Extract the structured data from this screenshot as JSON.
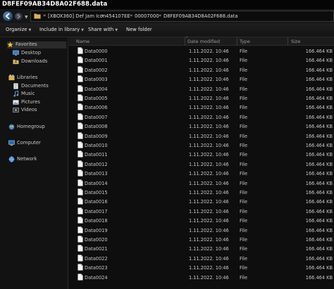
{
  "window": {
    "title": "D8FEF09AB34D8A02F688.data"
  },
  "address": {
    "segments": [
      "[XBOX360] Def Jam Icon",
      "454107EE",
      "00007000",
      "D8FEF09AB34D8A02F688.data"
    ],
    "separator": "»"
  },
  "toolbar": {
    "organize": "Organize",
    "include_in_library": "Include in library",
    "share_with": "Share with",
    "new_folder": "New folder",
    "dropdown_arrow": "▼"
  },
  "sidebar": {
    "favorites": "Favorites",
    "desktop": "Desktop",
    "downloads": "Downloads",
    "libraries": "Libraries",
    "documents": "Documents",
    "music": "Music",
    "pictures": "Pictures",
    "videos": "Videos",
    "homegroup": "Homegroup",
    "computer": "Computer",
    "network": "Network"
  },
  "columns": {
    "name": "Name",
    "date_modified": "Date modified",
    "type": "Type",
    "size": "Size"
  },
  "files": [
    {
      "name": "Data0000",
      "date": "1.11.2022. 10:46",
      "type": "File",
      "size": "166.464 KB"
    },
    {
      "name": "Data0001",
      "date": "1.11.2022. 10:46",
      "type": "File",
      "size": "166.464 KB"
    },
    {
      "name": "Data0002",
      "date": "1.11.2022. 10:46",
      "type": "File",
      "size": "166.464 KB"
    },
    {
      "name": "Data0003",
      "date": "1.11.2022. 10:46",
      "type": "File",
      "size": "166.464 KB"
    },
    {
      "name": "Data0004",
      "date": "1.11.2022. 10:46",
      "type": "File",
      "size": "166.464 KB"
    },
    {
      "name": "Data0005",
      "date": "1.11.2022. 10:46",
      "type": "File",
      "size": "166.464 KB"
    },
    {
      "name": "Data0006",
      "date": "1.11.2022. 10:46",
      "type": "File",
      "size": "166.464 KB"
    },
    {
      "name": "Data0007",
      "date": "1.11.2022. 10:46",
      "type": "File",
      "size": "166.464 KB"
    },
    {
      "name": "Data0008",
      "date": "1.11.2022. 10:46",
      "type": "File",
      "size": "166.464 KB"
    },
    {
      "name": "Data0009",
      "date": "1.11.2022. 10:46",
      "type": "File",
      "size": "166.464 KB"
    },
    {
      "name": "Data0010",
      "date": "1.11.2022. 10:46",
      "type": "File",
      "size": "166.464 KB"
    },
    {
      "name": "Data0011",
      "date": "1.11.2022. 10:46",
      "type": "File",
      "size": "166.464 KB"
    },
    {
      "name": "Data0012",
      "date": "1.11.2022. 10:46",
      "type": "File",
      "size": "166.464 KB"
    },
    {
      "name": "Data0013",
      "date": "1.11.2022. 10:46",
      "type": "File",
      "size": "166.464 KB"
    },
    {
      "name": "Data0014",
      "date": "1.11.2022. 10:46",
      "type": "File",
      "size": "166.464 KB"
    },
    {
      "name": "Data0015",
      "date": "1.11.2022. 10:46",
      "type": "File",
      "size": "166.464 KB"
    },
    {
      "name": "Data0016",
      "date": "1.11.2022. 10:46",
      "type": "File",
      "size": "166.464 KB"
    },
    {
      "name": "Data0017",
      "date": "1.11.2022. 10:46",
      "type": "File",
      "size": "166.464 KB"
    },
    {
      "name": "Data0018",
      "date": "1.11.2022. 10:46",
      "type": "File",
      "size": "166.464 KB"
    },
    {
      "name": "Data0019",
      "date": "1.11.2022. 10:46",
      "type": "File",
      "size": "166.464 KB"
    },
    {
      "name": "Data0020",
      "date": "1.11.2022. 10:46",
      "type": "File",
      "size": "166.464 KB"
    },
    {
      "name": "Data0021",
      "date": "1.11.2022. 10:46",
      "type": "File",
      "size": "166.464 KB"
    },
    {
      "name": "Data0022",
      "date": "1.11.2022. 10:46",
      "type": "File",
      "size": "166.464 KB"
    },
    {
      "name": "Data0023",
      "date": "1.11.2022. 10:46",
      "type": "File",
      "size": "166.464 KB"
    },
    {
      "name": "Data0024",
      "date": "1.11.2022. 10:46",
      "type": "File",
      "size": "166.464 KB"
    }
  ]
}
